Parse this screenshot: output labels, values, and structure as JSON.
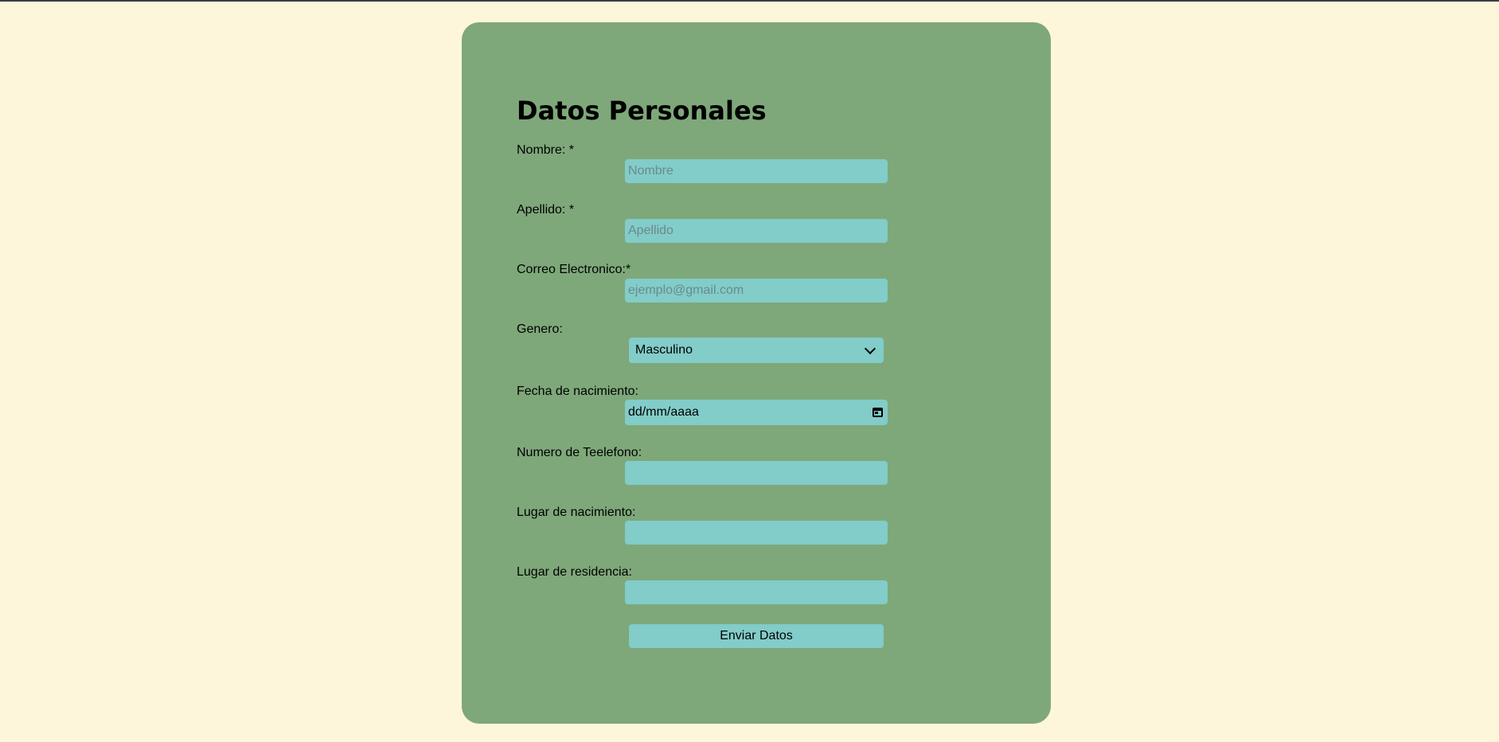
{
  "form": {
    "title": "Datos Personales",
    "nombre": {
      "label": "Nombre: *",
      "placeholder": "Nombre",
      "value": ""
    },
    "apellido": {
      "label": "Apellido: *",
      "placeholder": "Apellido",
      "value": ""
    },
    "correo": {
      "label": "Correo Electronico:*",
      "placeholder": "ejemplo@gmail.com",
      "value": ""
    },
    "genero": {
      "label": "Genero:",
      "selected": "Masculino"
    },
    "fecha": {
      "label": "Fecha de nacimiento:",
      "format": "dd/mm/aaaa"
    },
    "telefono": {
      "label": "Numero de Teelefono:",
      "value": ""
    },
    "lugar_nacimiento": {
      "label": "Lugar de nacimiento:",
      "value": ""
    },
    "lugar_residencia": {
      "label": "Lugar de residencia:",
      "value": ""
    },
    "submit_label": "Enviar Datos"
  },
  "icons": {
    "select_arrow": "chevron-down-icon",
    "date_picker": "calendar-icon"
  },
  "colors": {
    "page_background": "#fef6da",
    "card_background": "#7ea87a",
    "field_background": "#82ccc9"
  }
}
